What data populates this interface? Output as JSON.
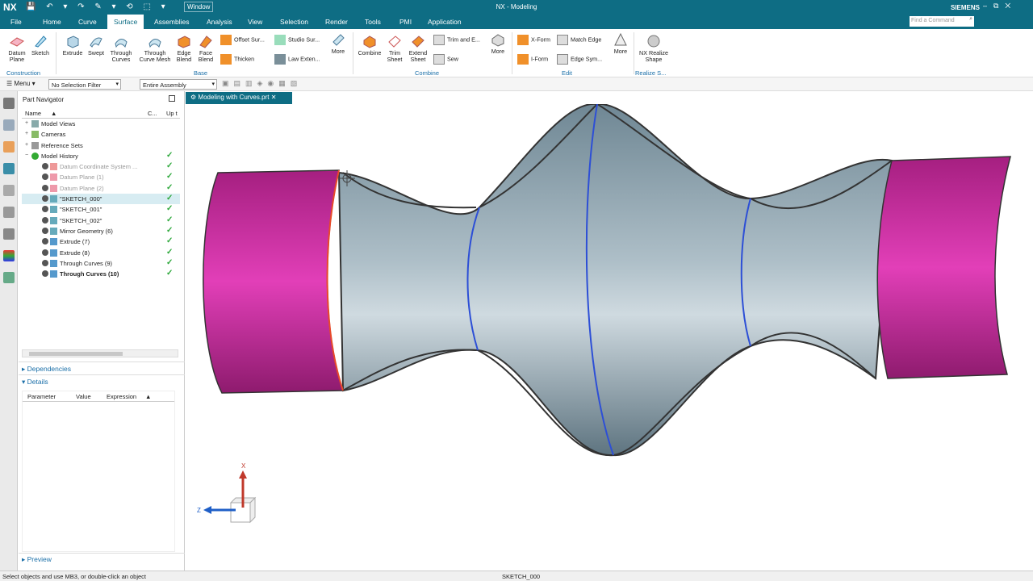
{
  "titlebar": {
    "logo": "NX",
    "menu_window": "Window",
    "app_title": "NX - Modeling",
    "brand": "SIEMENS"
  },
  "menubar": {
    "items": [
      "File",
      "Home",
      "Curve",
      "Surface",
      "Assemblies",
      "Analysis",
      "View",
      "Selection",
      "Render",
      "Tools",
      "PMI",
      "Application"
    ],
    "active": "Surface",
    "find_placeholder": "Find a Command"
  },
  "ribbon": {
    "construction": {
      "group": "Construction",
      "datum": "Datum\nPlane",
      "sketch": "Sketch"
    },
    "base": {
      "group": "Base",
      "extrude": "Extrude",
      "swept": "Swept",
      "through_curves": "Through\nCurves",
      "through_curve_mesh": "Through\nCurve Mesh",
      "edge_blend": "Edge\nBlend",
      "face_blend": "Face\nBlend",
      "offset_surface": "Offset Sur...",
      "thicken": "Thicken",
      "studio_surface": "Studio Sur...",
      "law_extension": "Law Exten...",
      "more": "More"
    },
    "combine": {
      "group": "Combine",
      "combine": "Combine",
      "trim_sheet": "Trim\nSheet",
      "extend_sheet": "Extend\nSheet",
      "trim_extend": "Trim and E...",
      "sew": "Sew",
      "more": "More"
    },
    "edit": {
      "group": "Edit",
      "xform": "X-Form",
      "iform": "I-Form",
      "match_edge": "Match Edge",
      "edge_symmetry": "Edge Sym...",
      "more": "More"
    },
    "realize": {
      "group": "Realize S...",
      "nx_realize": "NX Realize\nShape"
    }
  },
  "toolbar2": {
    "menu": "Menu",
    "selection_filter": "No Selection Filter",
    "assembly": "Entire Assembly"
  },
  "navigator": {
    "title": "Part Navigator",
    "columns": {
      "name": "Name",
      "c": "C...",
      "up": "Up t"
    },
    "rows": [
      {
        "label": "Model Views",
        "level": 0,
        "exp": "+",
        "type": "views",
        "check": false,
        "state": "normal"
      },
      {
        "label": "Cameras",
        "level": 0,
        "exp": "+",
        "type": "camera",
        "check": false,
        "state": "normal"
      },
      {
        "label": "Reference Sets",
        "level": 0,
        "exp": "+",
        "type": "folder",
        "check": false,
        "state": "normal"
      },
      {
        "label": "Model History",
        "level": 0,
        "exp": "−",
        "type": "history",
        "check": true,
        "state": "normal"
      },
      {
        "label": "Datum Coordinate System ...",
        "level": 1,
        "type": "datum",
        "check": true,
        "state": "dim"
      },
      {
        "label": "Datum Plane (1)",
        "level": 1,
        "type": "plane",
        "check": true,
        "state": "dim"
      },
      {
        "label": "Datum Plane (2)",
        "level": 1,
        "type": "plane",
        "check": true,
        "state": "dim"
      },
      {
        "label": "\"SKETCH_000\"",
        "level": 1,
        "type": "sketch",
        "check": true,
        "state": "sel"
      },
      {
        "label": "\"SKETCH_001\"",
        "level": 1,
        "type": "sketch",
        "check": true,
        "state": "normal"
      },
      {
        "label": "\"SKETCH_002\"",
        "level": 1,
        "type": "sketch",
        "check": true,
        "state": "normal"
      },
      {
        "label": "Mirror Geometry (6)",
        "level": 1,
        "type": "mirror",
        "check": true,
        "state": "normal"
      },
      {
        "label": "Extrude (7)",
        "level": 1,
        "type": "extrude",
        "check": true,
        "state": "normal"
      },
      {
        "label": "Extrude (8)",
        "level": 1,
        "type": "extrude",
        "check": true,
        "state": "normal"
      },
      {
        "label": "Through Curves (9)",
        "level": 1,
        "type": "through",
        "check": true,
        "state": "normal"
      },
      {
        "label": "Through Curves (10)",
        "level": 1,
        "type": "through",
        "check": true,
        "state": "bold"
      }
    ],
    "dependencies": "Dependencies",
    "details": "Details",
    "details_columns": [
      "Parameter",
      "Value",
      "Expression"
    ],
    "preview": "Preview"
  },
  "viewport": {
    "tab": "Modeling with Curves.prt",
    "axis_x": "X",
    "axis_z": "Z"
  },
  "status": {
    "left": "Select objects and use MB3, or double-click an object",
    "center": "SKETCH_000"
  },
  "colors": {
    "accent": "#0e6d84",
    "body": "#8fa8b4",
    "magenta": "#d32aa6",
    "check": "#2da83b"
  }
}
